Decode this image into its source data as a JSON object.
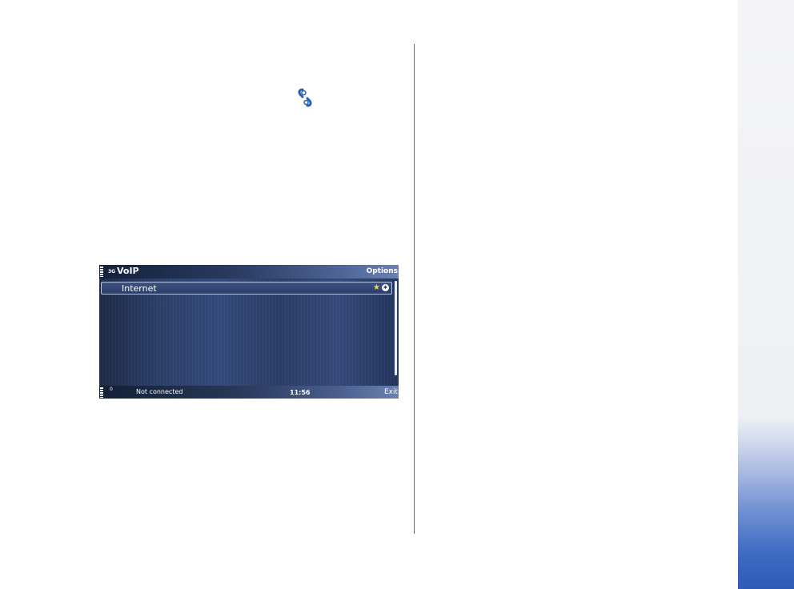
{
  "phone": {
    "network_type": "3G",
    "app_title": "VoIP",
    "options_label": "Options",
    "list_items": [
      {
        "label": "Internet",
        "status_badge": "✱"
      }
    ],
    "indicator_zero": "0",
    "status_text": "Not connected",
    "clock": "11:56",
    "exit_label": "Exit"
  },
  "colors": {
    "divider": "#2a6fc4",
    "tab_gradient_end": "#2d5cb6",
    "screen_bg": "#27385a",
    "star": "#f2d65a"
  },
  "icons": [
    "voip-app-icon",
    "signal-icon",
    "star-icon",
    "badge-icon",
    "battery-icon"
  ]
}
